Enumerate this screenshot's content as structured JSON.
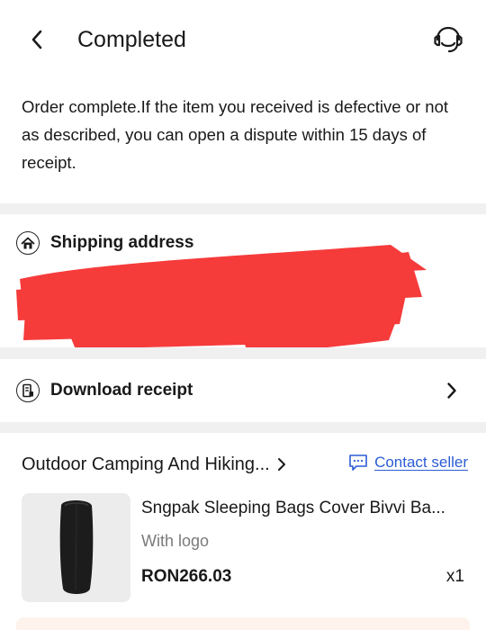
{
  "header": {
    "title": "Completed",
    "back_icon": "chevron-left-icon",
    "support_icon": "headset-icon"
  },
  "notice": {
    "text": "Order complete.If the item you received is defective or not as described, you can open a dispute within 15 days of receipt."
  },
  "shipping": {
    "label": "Shipping address",
    "icon": "home-icon",
    "redaction_color": "#f63b3b"
  },
  "receipt": {
    "label": "Download receipt",
    "icon": "receipt-icon"
  },
  "store": {
    "name": "Outdoor Camping And Hiking...",
    "contact_label": "Contact seller",
    "contact_icon": "chat-icon",
    "link_color": "#2b5cd6"
  },
  "product": {
    "title": "Sngpak Sleeping Bags Cover Bivvi Ba...",
    "variant": "With logo",
    "price": "RON266.03",
    "quantity": "x1"
  }
}
